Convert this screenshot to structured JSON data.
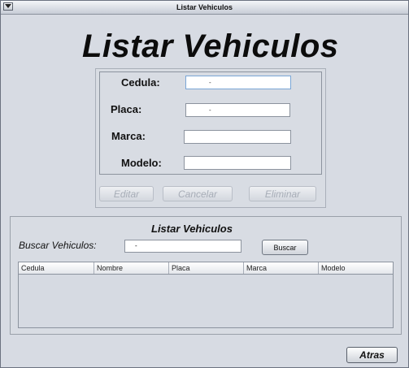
{
  "window": {
    "title": "Listar Vehiculos",
    "menu_icon": "window-menu-icon"
  },
  "header": {
    "title": "Listar Vehiculos"
  },
  "form": {
    "cedula": {
      "label": "Cedula:",
      "value": "-"
    },
    "placa": {
      "label": "Placa:",
      "value": "-"
    },
    "marca": {
      "label": "Marca:",
      "value": ""
    },
    "modelo": {
      "label": "Modelo:",
      "value": ""
    },
    "buttons": {
      "editar": "Editar",
      "cancelar": "Cancelar",
      "eliminar": "Eliminar"
    }
  },
  "list": {
    "title": "Listar Vehiculos",
    "search_label": "Buscar Vehiculos:",
    "search_value": "-",
    "search_button": "Buscar",
    "columns": [
      "Cedula",
      "Nombre",
      "Placa",
      "Marca",
      "Modelo"
    ],
    "rows": []
  },
  "footer": {
    "back_button": "Atras"
  }
}
